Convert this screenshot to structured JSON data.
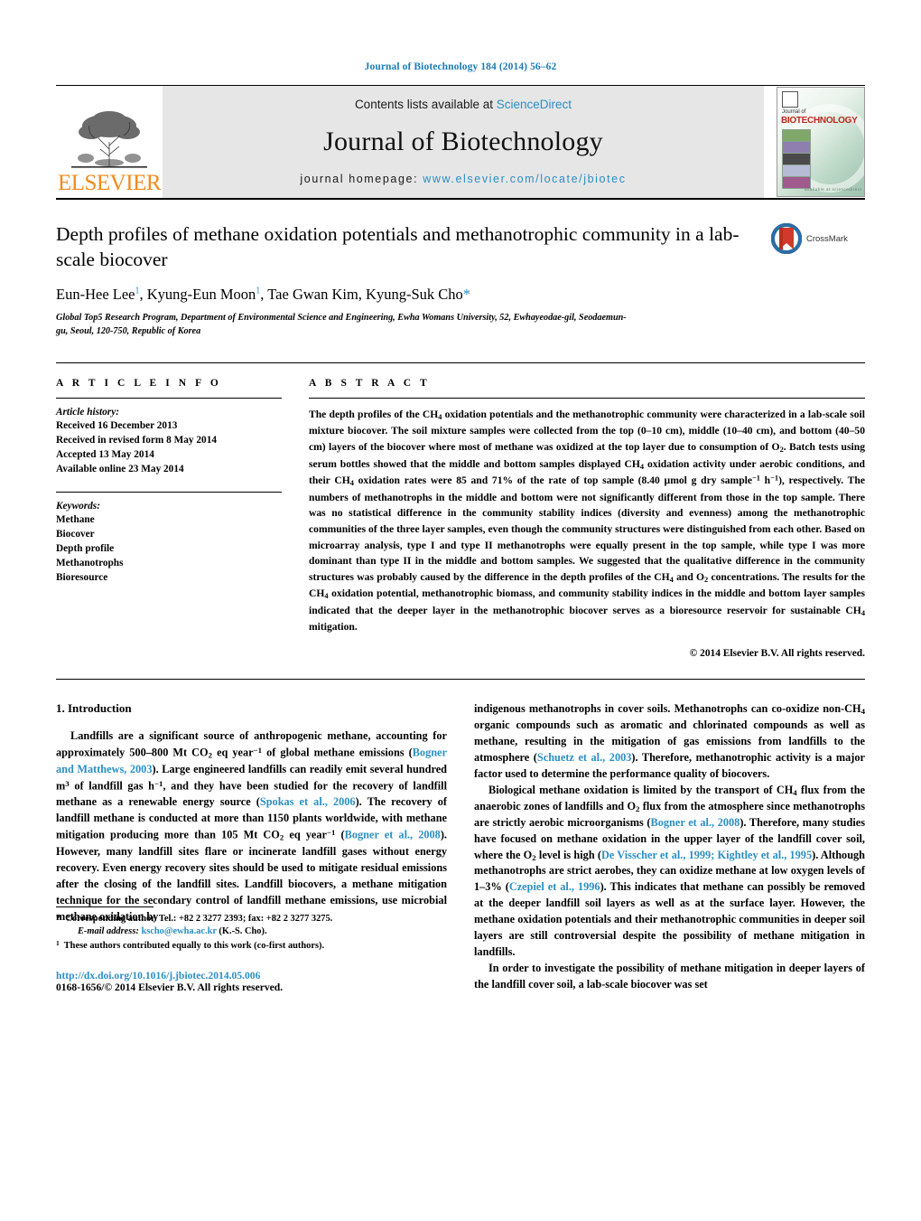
{
  "running_head": "Journal of Biotechnology 184 (2014) 56–62",
  "masthead": {
    "publisher": "ELSEVIER",
    "contents_prefix": "Contents lists available at ",
    "contents_link": "ScienceDirect",
    "journal_title": "Journal of Biotechnology",
    "homepage_label": "journal homepage: ",
    "homepage_url": "www.elsevier.com/locate/jbiotec",
    "cover": {
      "kicker": "Journal of",
      "title": "BIOTECHNOLOGY",
      "footer": "available at sciencedirect"
    }
  },
  "article": {
    "title": "Depth profiles of methane oxidation potentials and methanotrophic community in a lab-scale biocover",
    "crossmark_label": "CrossMark",
    "authors_html": "Eun-Hee Lee<sup>1</sup>, Kyung-Eun Moon<sup>1</sup>, Tae Gwan Kim, Kyung-Suk Cho<span class=\"star\">*</span>",
    "affiliation": "Global Top5 Research Program, Department of Environmental Science and Engineering, Ewha Womans University, 52, Ewhayeodae-gil, Seodaemun-gu, Seoul, 120-750, Republic of Korea"
  },
  "info": {
    "heading": "A R T I C L E   I N F O",
    "history_label": "Article history:",
    "history": [
      "Received 16 December 2013",
      "Received in revised form 8 May 2014",
      "Accepted 13 May 2014",
      "Available online 23 May 2014"
    ],
    "keywords_label": "Keywords:",
    "keywords": [
      "Methane",
      "Biocover",
      "Depth profile",
      "Methanotrophs",
      "Bioresource"
    ]
  },
  "abstract": {
    "heading": "A B S T R A C T",
    "text_html": "The depth profiles of the CH<sub>4</sub> oxidation potentials and the methanotrophic community were characterized in a lab-scale soil mixture biocover. The soil mixture samples were collected from the top (0–10 cm), middle (10–40 cm), and bottom (40–50 cm) layers of the biocover where most of methane was oxidized at the top layer due to consumption of O<sub>2</sub>. Batch tests using serum bottles showed that the middle and bottom samples displayed CH<sub>4</sub> oxidation activity under aerobic conditions, and their CH<sub>4</sub> oxidation rates were 85 and 71% of the rate of top sample (8.40 &#181;mol g dry sample<sup>−1</sup> h<sup>−1</sup>), respectively. The numbers of methanotrophs in the middle and bottom were not significantly different from those in the top sample. There was no statistical difference in the community stability indices (diversity and evenness) among the methanotrophic communities of the three layer samples, even though the community structures were distinguished from each other. Based on microarray analysis, type I and type II methanotrophs were equally present in the top sample, while type I was more dominant than type II in the middle and bottom samples. We suggested that the qualitative difference in the community structures was probably caused by the difference in the depth profiles of the CH<sub>4</sub> and O<sub>2</sub> concentrations. The results for the CH<sub>4</sub> oxidation potential, methanotrophic biomass, and community stability indices in the middle and bottom layer samples indicated that the deeper layer in the methanotrophic biocover serves as a bioresource reservoir for sustainable CH<sub>4</sub> mitigation.",
    "copyright": "© 2014 Elsevier B.V. All rights reserved."
  },
  "body": {
    "section_title": "1.  Introduction",
    "left_html": "<span class=\"indent\">Landfills are a significant source of anthropogenic methane, accounting for approximately 500–800 Mt CO<sub>2</sub> eq year<sup>−1</sup> of global methane emissions (<span class=\"lnk\">Bogner and Matthews, 2003</span>). Large engineered landfills can readily emit several hundred m<sup>3</sup> of landfill gas h<sup>−1</sup>, and they have been studied for the recovery of landfill methane as a renewable energy source (<span class=\"lnk\">Spokas et al., 2006</span>). The recovery of landfill methane is conducted at more than 1150 plants worldwide, with methane mitigation producing more than 105 Mt CO<sub>2</sub> eq year<sup>−1</sup> (<span class=\"lnk\">Bogner et al., 2008</span>). However, many landfill sites flare or incinerate landfill gases without energy recovery. Even energy recovery sites should be used to mitigate residual emissions after the closing of the landfill sites. Landfill biocovers, a methane mitigation technique for the secondary control of landfill methane emissions, use microbial methane oxidation by</span>",
    "right_html": "indigenous methanotrophs in cover soils. Methanotrophs can co-oxidize non-CH<sub>4</sub> organic compounds such as aromatic and chlorinated compounds as well as methane, resulting in the mitigation of gas emissions from landfills to the atmosphere (<span class=\"lnk\">Schuetz et al., 2003</span>). Therefore, methanotrophic activity is a major factor used to determine the performance quality of biocovers.<span class=\"indent\">Biological methane oxidation is limited by the transport of CH<sub>4</sub> flux from the anaerobic zones of landfills and O<sub>2</sub> flux from the atmosphere since methanotrophs are strictly aerobic microorganisms (<span class=\"lnk\">Bogner et al., 2008</span>). Therefore, many studies have focused on methane oxidation in the upper layer of the landfill cover soil, where the O<sub>2</sub> level is high (<span class=\"lnk\">De Visscher et al., 1999; Kightley et al., 1995</span>). Although methanotrophs are strict aerobes, they can oxidize methane at low oxygen levels of 1–3% (<span class=\"lnk\">Czepiel et al., 1996</span>). This indicates that methane can possibly be removed at the deeper landfill soil layers as well as at the surface layer. However, the methane oxidation potentials and their methanotrophic communities in deeper soil layers are still controversial despite the possibility of methane mitigation in landfills.</span><span class=\"indent\">In order to investigate the possibility of methane mitigation in deeper layers of the landfill cover soil, a lab-scale biocover was set</span>"
  },
  "footnotes": {
    "corresponding_html": "<span class=\"star-mark\">*</span>&nbsp; Corresponding author. Tel.: +82 2 3277 2393; fax: +82 2 3277 3275.",
    "email_html": "<span class=\"ital\">E-mail address:</span> <span class=\"lnk\">kscho@ewha.ac.kr</span> (K.-S. Cho).",
    "equal_contrib_html": "<sup>1</sup>&nbsp; These authors contributed equally to this work (co-first authors).",
    "doi": "http://dx.doi.org/10.1016/j.jbiotec.2014.05.006",
    "issn_line": "0168-1656/© 2014 Elsevier B.V. All rights reserved."
  },
  "colors": {
    "link_blue": "#2a8fc4",
    "elsevier_orange": "#f08a1c",
    "banner_gray": "#e6e6e6",
    "cover_red": "#c0271d"
  }
}
